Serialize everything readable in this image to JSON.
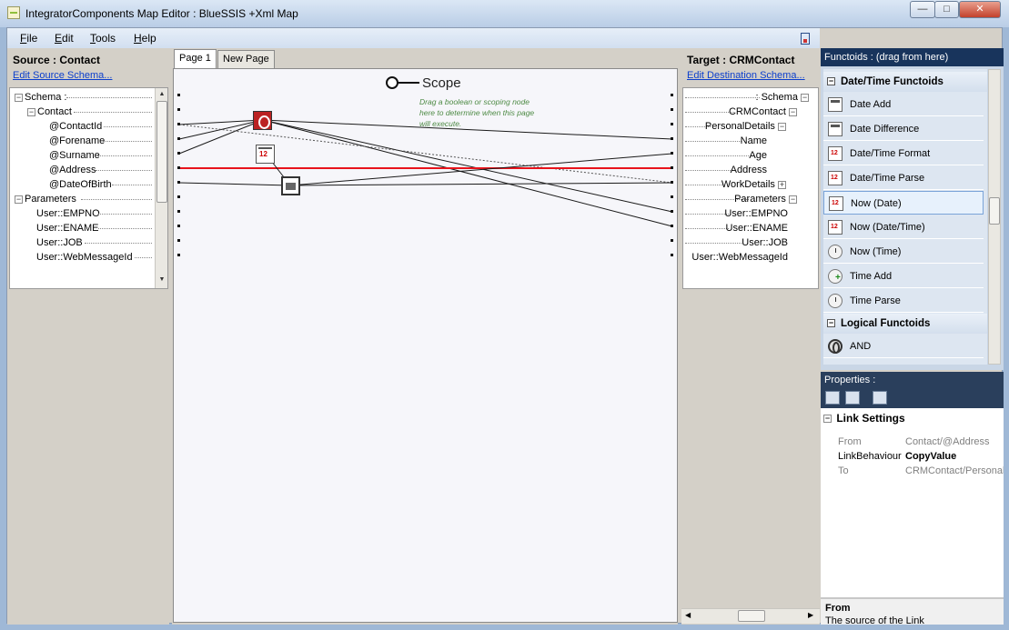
{
  "window": {
    "title": "IntegratorComponents Map Editor : BlueSSIS +Xml Map",
    "minimize": "—",
    "maximize": "□",
    "close": "✕"
  },
  "menu": [
    {
      "key": "F",
      "rest": "ile"
    },
    {
      "key": "E",
      "rest": "dit"
    },
    {
      "key": "T",
      "rest": "ools"
    },
    {
      "key": "H",
      "rest": "elp"
    }
  ],
  "source": {
    "title": "Source : Contact",
    "edit_link": "Edit Source Schema...",
    "nodes": [
      "Schema :",
      "Contact",
      "@ContactId",
      "@Forename",
      "@Surname",
      "@Address",
      "@DateOfBirth",
      "Parameters",
      "User::EMPNO",
      "User::ENAME",
      "User::JOB",
      "User::WebMessageId"
    ]
  },
  "target": {
    "title": "Target : CRMContact",
    "edit_link": "Edit Destination Schema...",
    "nodes": [
      ": Schema",
      "CRMContact",
      "PersonalDetails",
      "Name",
      "Age",
      "Address",
      "WorkDetails",
      "Parameters",
      "User::EMPNO",
      "User::ENAME",
      "User::JOB",
      "User::WebMessageId"
    ]
  },
  "tabs": [
    "Page 1",
    "New Page"
  ],
  "scope": {
    "label": "Scope",
    "hint": "Drag a boolean or scoping node here to determine when this page will execute."
  },
  "functoids": {
    "header": "Functoids : (drag from here)",
    "categories": [
      {
        "name": "Date/Time Functoids",
        "items": [
          "Date Add",
          "Date Difference",
          "Date/Time Format",
          "Date/Time Parse",
          "Now (Date)",
          "Now (Date/Time)",
          "Now (Time)",
          "Time Add",
          "Time Parse"
        ]
      },
      {
        "name": "Logical Functoids",
        "items": [
          "AND"
        ]
      }
    ],
    "selected": "Now (Date)"
  },
  "properties": {
    "title": "Properties :",
    "category": "Link Settings",
    "rows": [
      {
        "name": "From",
        "value": "Contact/@Address"
      },
      {
        "name": "LinkBehaviour",
        "value": "CopyValue"
      },
      {
        "name": "To",
        "value": "CRMContact/PersonalDetails/Address"
      }
    ],
    "desc_title": "From",
    "desc_text": "The source of the Link"
  },
  "colors": {
    "selected_link": "#e8131b",
    "link": "#1a1a1a",
    "dotted_link": "#555555",
    "panel_header": "#18345c"
  }
}
